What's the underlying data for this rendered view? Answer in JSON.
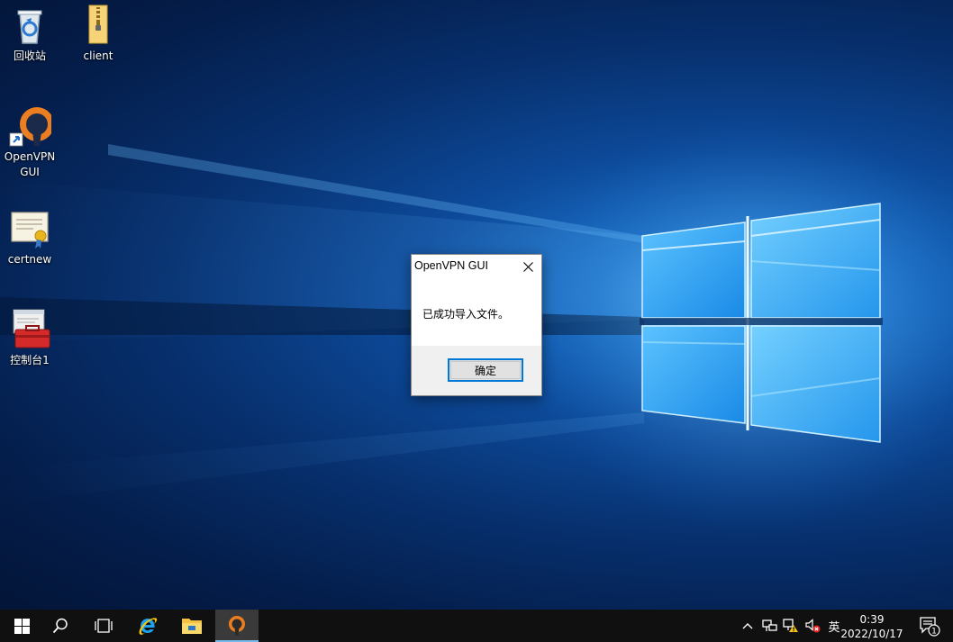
{
  "desktop": {
    "icons": [
      {
        "label": "回收站",
        "icon": "recycle-bin-icon"
      },
      {
        "label": "client",
        "icon": "folder-zip-icon"
      },
      {
        "label": "OpenVPN GUI",
        "icon": "openvpn-icon"
      },
      {
        "label": "certnew",
        "icon": "certificate-icon"
      },
      {
        "label": "控制台1",
        "icon": "mmc-console-icon"
      }
    ]
  },
  "dialog": {
    "title": "OpenVPN GUI",
    "message": "已成功导入文件。",
    "ok_label": "确定"
  },
  "taskbar": {
    "items": [
      "start-icon",
      "search-icon",
      "task-view-icon",
      "internet-explorer-icon",
      "file-explorer-icon",
      "openvpn-icon"
    ],
    "active_item": "openvpn-icon",
    "tray": {
      "icons": [
        "chevron-up-icon",
        "network-icon",
        "warning-network-icon",
        "speaker-muted-icon"
      ],
      "language": "英",
      "time": "0:39",
      "date": "2022/10/17",
      "notification_count": "1"
    }
  },
  "colors": {
    "accent": "#0078d7",
    "taskbar": "#101010",
    "openvpn_orange": "#ea7e20"
  }
}
